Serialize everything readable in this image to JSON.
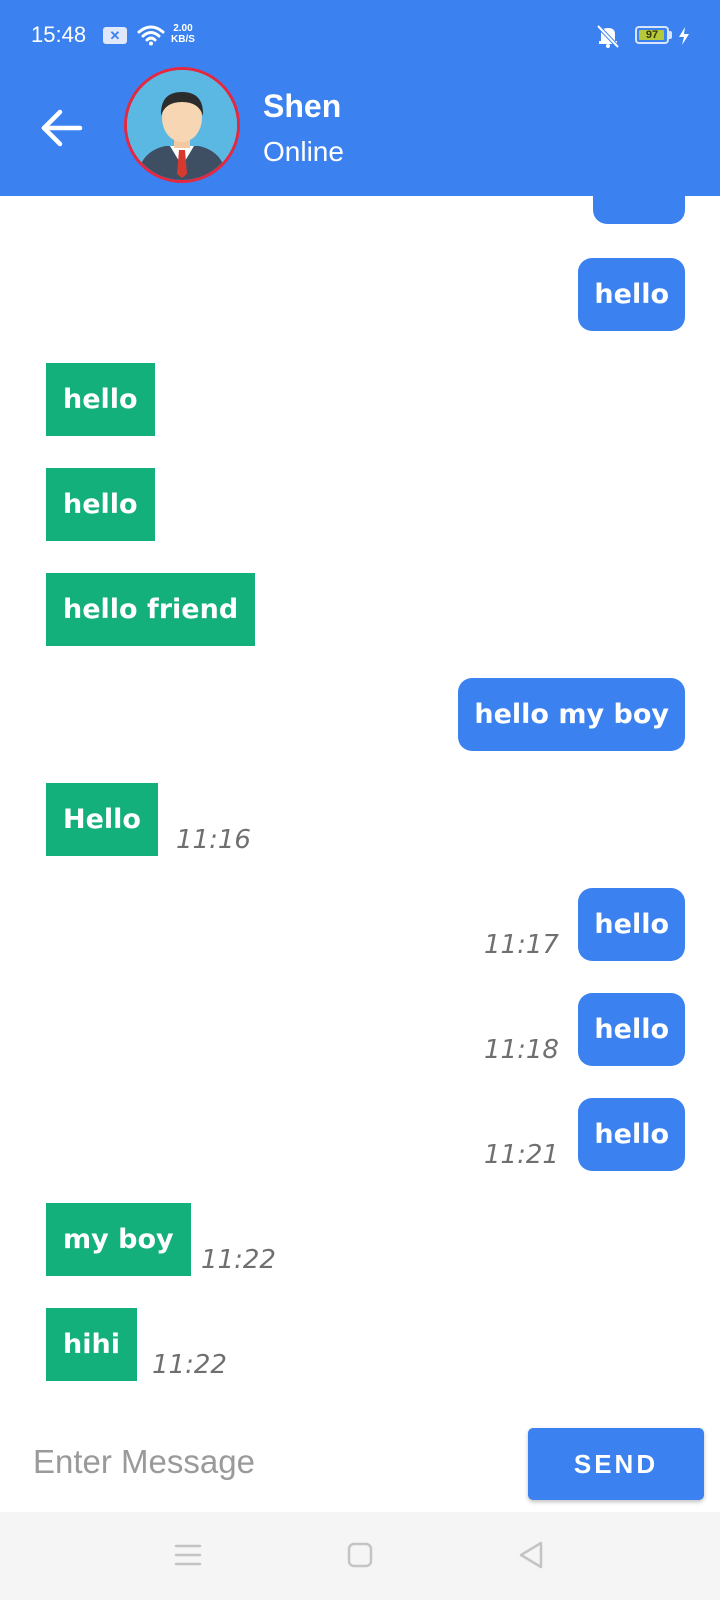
{
  "status_bar": {
    "time": "15:48",
    "network_speed_value": "2.00",
    "network_speed_unit": "KB/S",
    "battery": "97",
    "battery_level": 0.97
  },
  "header": {
    "contact_name": "Shen",
    "contact_status": "Online",
    "colors": {
      "bar": "#3b82f0",
      "avatar_ring": "#e5273f"
    }
  },
  "messages": [
    {
      "text": "hello",
      "direction": "sent",
      "time": ""
    },
    {
      "text": "hello",
      "direction": "received",
      "time": ""
    },
    {
      "text": "hello",
      "direction": "received",
      "time": ""
    },
    {
      "text": "hello friend",
      "direction": "received",
      "time": ""
    },
    {
      "text": "hello my boy",
      "direction": "sent",
      "time": ""
    },
    {
      "text": "Hello",
      "direction": "received",
      "time": "11:16"
    },
    {
      "text": "hello",
      "direction": "sent",
      "time": "11:17"
    },
    {
      "text": "hello",
      "direction": "sent",
      "time": "11:18"
    },
    {
      "text": "hello",
      "direction": "sent",
      "time": "11:21"
    },
    {
      "text": "my boy",
      "direction": "received",
      "time": "11:22"
    },
    {
      "text": "hihi",
      "direction": "received",
      "time": "11:22"
    }
  ],
  "composer": {
    "placeholder": "Enter Message",
    "value": "",
    "send_label": "SEND"
  },
  "colors": {
    "sent": "#3b82f0",
    "received": "#14b07c",
    "time": "#6f6f6f"
  }
}
